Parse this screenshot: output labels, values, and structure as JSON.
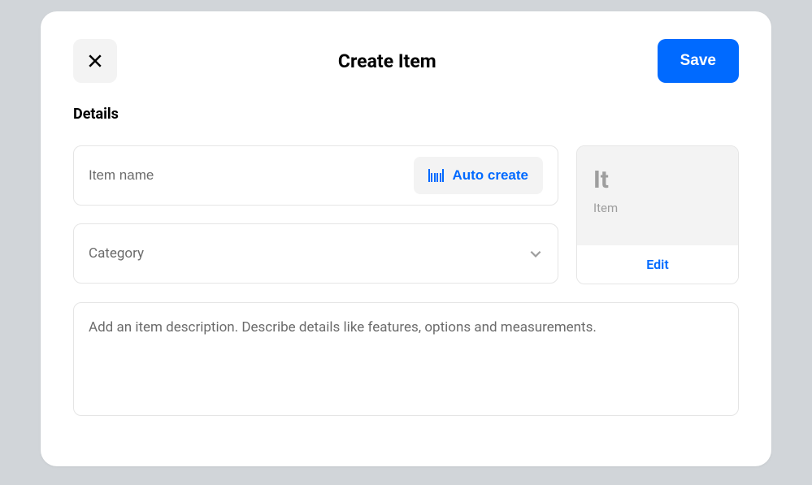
{
  "header": {
    "title": "Create Item",
    "save_label": "Save"
  },
  "details": {
    "section_title": "Details",
    "name_placeholder": "Item name",
    "auto_create_label": "Auto create",
    "category_placeholder": "Category",
    "description_placeholder": "Add an item description. Describe details like features, options and measurements."
  },
  "preview": {
    "abbrev": "It",
    "label": "Item",
    "edit_label": "Edit"
  }
}
